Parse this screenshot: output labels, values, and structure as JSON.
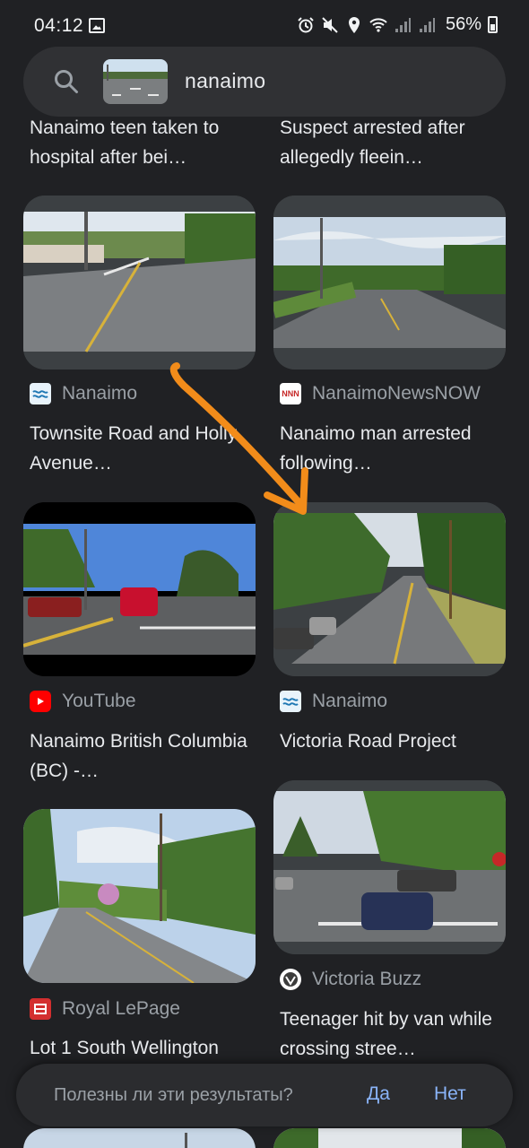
{
  "status": {
    "time": "04:12",
    "battery": "56%"
  },
  "search": {
    "query": "nanaimo"
  },
  "results": [
    {
      "source": "",
      "title": "Nanaimo teen taken to hospital after bei…"
    },
    {
      "source": "",
      "title": "Suspect arrested after allegedly fleein…"
    },
    {
      "source": "Nanaimo",
      "title": "Townsite Road and Holly Avenue…",
      "icon": "nanaimo-city-icon"
    },
    {
      "source": "NanaimoNewsNOW",
      "title": "Nanaimo man arrested following…",
      "icon": "nnn-icon"
    },
    {
      "source": "YouTube",
      "title": "Nanaimo British Columbia (BC) -…",
      "icon": "youtube-icon"
    },
    {
      "source": "Nanaimo",
      "title": "Victoria Road Project",
      "icon": "nanaimo-city-icon"
    },
    {
      "source": "Royal LePage",
      "title": "Lot 1 South Wellington",
      "icon": "royal-lepage-icon"
    },
    {
      "source": "Victoria Buzz",
      "title": "Teenager hit by van while crossing stree…",
      "icon": "victoria-buzz-icon"
    }
  ],
  "feedback": {
    "question": "Полезны ли эти результаты?",
    "yes": "Да",
    "no": "Нет"
  },
  "colors": {
    "background": "#202124",
    "link_blue": "#8ab4f8",
    "annotation_arrow": "#f28c1a"
  }
}
